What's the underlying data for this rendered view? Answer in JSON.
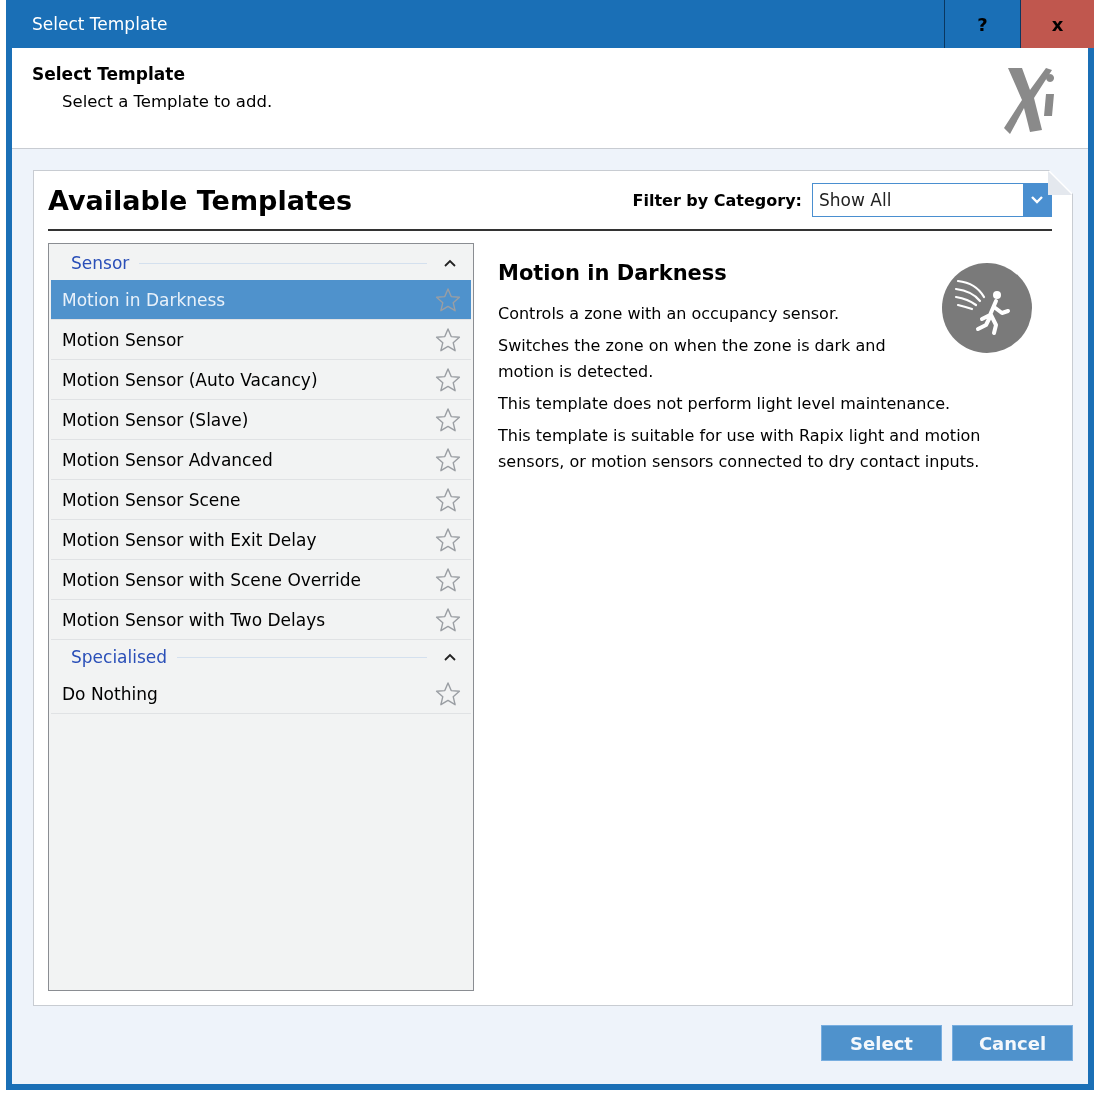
{
  "window": {
    "title": "Select Template",
    "help": "?",
    "close": "x"
  },
  "header": {
    "title": "Select Template",
    "subtitle": "Select a Template to add."
  },
  "panel": {
    "title": "Available Templates",
    "filter_label": "Filter by Category:",
    "filter_value": "Show All"
  },
  "groups": [
    {
      "name": "Sensor",
      "expanded": true,
      "items": [
        {
          "label": "Motion in Darkness",
          "selected": true,
          "favorite": false
        },
        {
          "label": "Motion Sensor",
          "selected": false,
          "favorite": false
        },
        {
          "label": "Motion Sensor (Auto Vacancy)",
          "selected": false,
          "favorite": false
        },
        {
          "label": "Motion Sensor (Slave)",
          "selected": false,
          "favorite": false
        },
        {
          "label": "Motion Sensor Advanced",
          "selected": false,
          "favorite": false
        },
        {
          "label": "Motion Sensor Scene",
          "selected": false,
          "favorite": false
        },
        {
          "label": "Motion Sensor with Exit Delay",
          "selected": false,
          "favorite": false
        },
        {
          "label": "Motion Sensor with Scene Override",
          "selected": false,
          "favorite": false
        },
        {
          "label": "Motion Sensor with Two Delays",
          "selected": false,
          "favorite": false
        }
      ]
    },
    {
      "name": "Specialised",
      "expanded": true,
      "items": [
        {
          "label": "Do Nothing",
          "selected": false,
          "favorite": false
        }
      ]
    }
  ],
  "details": {
    "title": "Motion in Darkness",
    "paragraphs": [
      "Controls a zone with an occupancy sensor.",
      "Switches the zone on when the zone is dark and motion is detected.",
      "This template does not perform light level maintenance.",
      "This template is suitable for use with Rapix light and motion sensors, or motion sensors connected to dry contact inputs."
    ]
  },
  "buttons": [
    "Select",
    "Cancel"
  ]
}
